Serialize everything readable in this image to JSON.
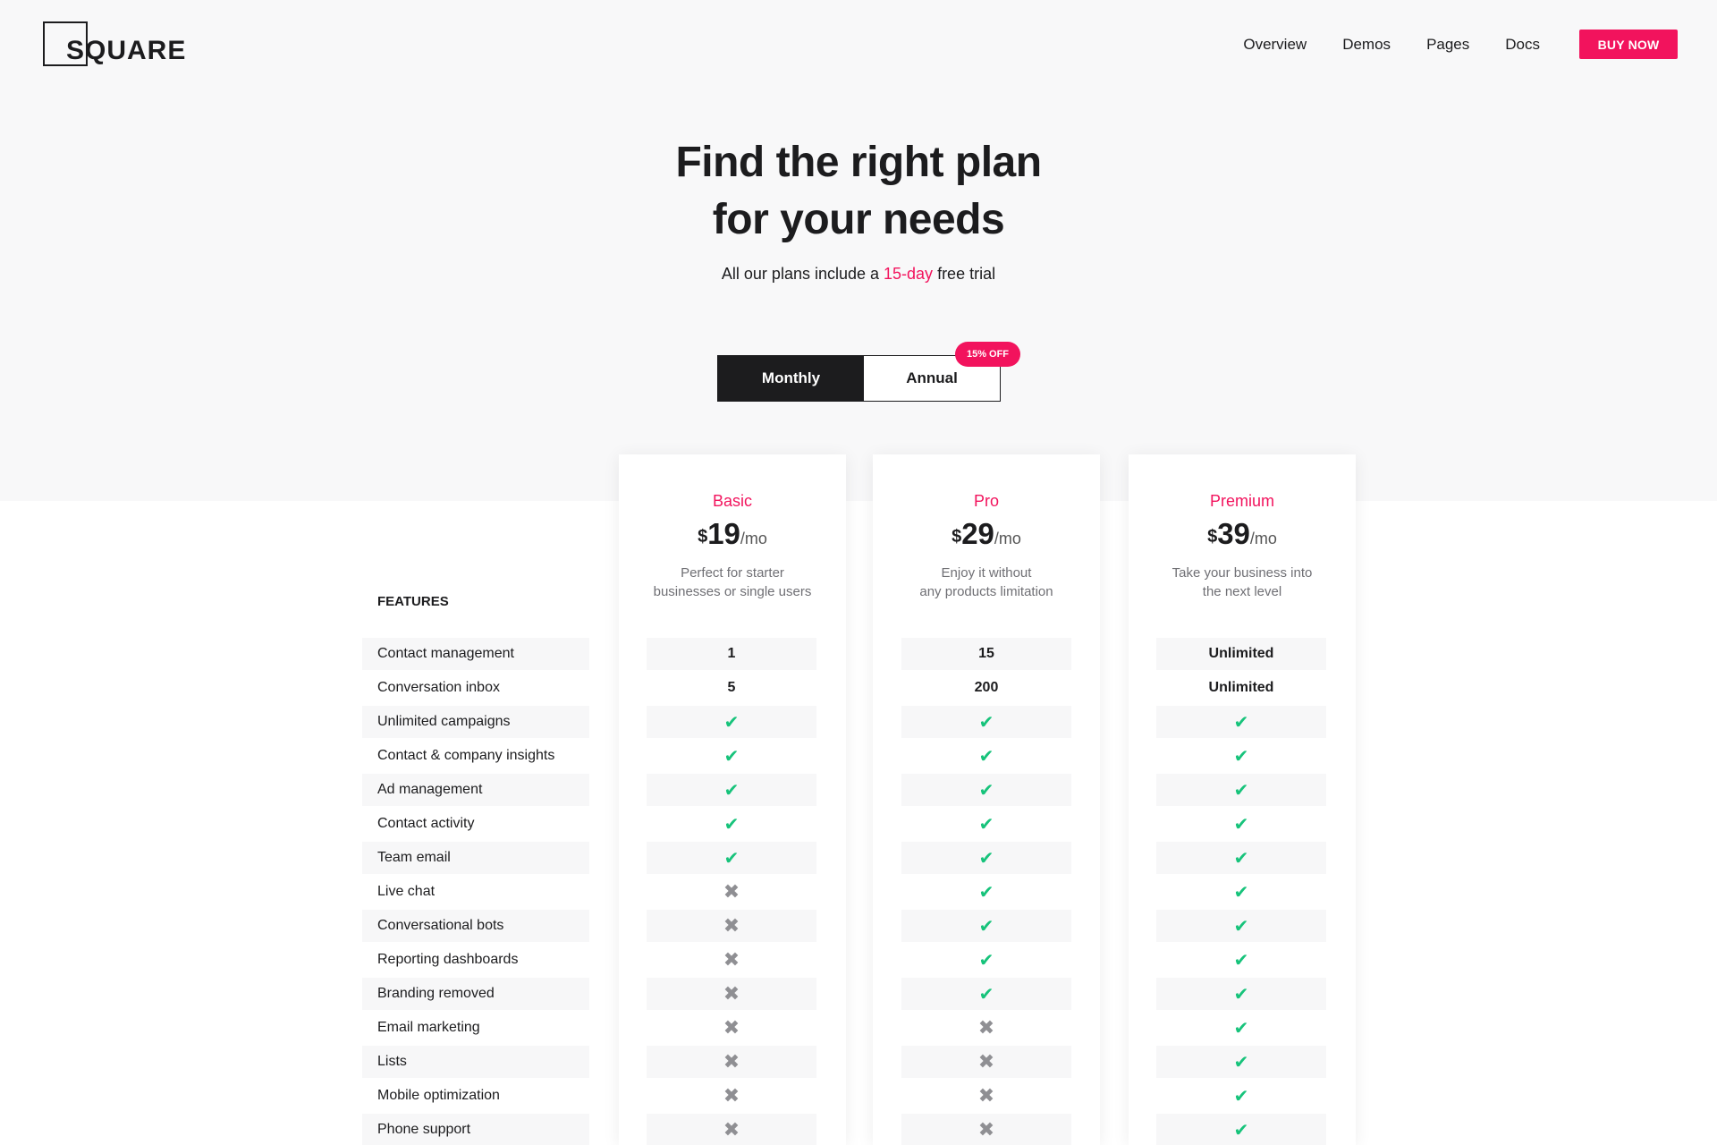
{
  "logo": {
    "text": "SQUARE"
  },
  "nav": {
    "links": [
      "Overview",
      "Demos",
      "Pages",
      "Docs"
    ],
    "buy_label": "BUY NOW"
  },
  "hero": {
    "title_line1": "Find the right plan",
    "title_line2": "for your needs",
    "subtitle_pre": "All our plans include a ",
    "subtitle_accent": "15-day",
    "subtitle_post": " free trial"
  },
  "billing_toggle": {
    "monthly_label": "Monthly",
    "annual_label": "Annual",
    "badge": "15% OFF",
    "selected": "Monthly"
  },
  "features_title": "FEATURES",
  "features": [
    "Contact management",
    "Conversation inbox",
    "Unlimited campaigns",
    "Contact & company insights",
    "Ad management",
    "Contact activity",
    "Team email",
    "Live chat",
    "Conversational bots",
    "Reporting dashboards",
    "Branding removed",
    "Email marketing",
    "Lists",
    "Mobile optimization",
    "Phone support"
  ],
  "plans": [
    {
      "name": "Basic",
      "currency": "$",
      "price": "19",
      "period": "/mo",
      "desc_line1": "Perfect for starter",
      "desc_line2": "businesses or single users",
      "values": [
        "1",
        "5",
        "check",
        "check",
        "check",
        "check",
        "check",
        "cross",
        "cross",
        "cross",
        "cross",
        "cross",
        "cross",
        "cross",
        "cross"
      ]
    },
    {
      "name": "Pro",
      "currency": "$",
      "price": "29",
      "period": "/mo",
      "desc_line1": "Enjoy it without",
      "desc_line2": "any products limitation",
      "values": [
        "15",
        "200",
        "check",
        "check",
        "check",
        "check",
        "check",
        "check",
        "check",
        "check",
        "check",
        "cross",
        "cross",
        "cross",
        "cross"
      ]
    },
    {
      "name": "Premium",
      "currency": "$",
      "price": "39",
      "period": "/mo",
      "desc_line1": "Take your business into",
      "desc_line2": "the next level",
      "values": [
        "Unlimited",
        "Unlimited",
        "check",
        "check",
        "check",
        "check",
        "check",
        "check",
        "check",
        "check",
        "check",
        "check",
        "check",
        "check",
        "check"
      ]
    }
  ],
  "colors": {
    "accent": "#f2135d",
    "check": "#17c37b",
    "cross": "#8f8f93",
    "dark": "#1c1c1e"
  },
  "icons": {
    "check": "check-icon",
    "cross": "cross-icon"
  }
}
